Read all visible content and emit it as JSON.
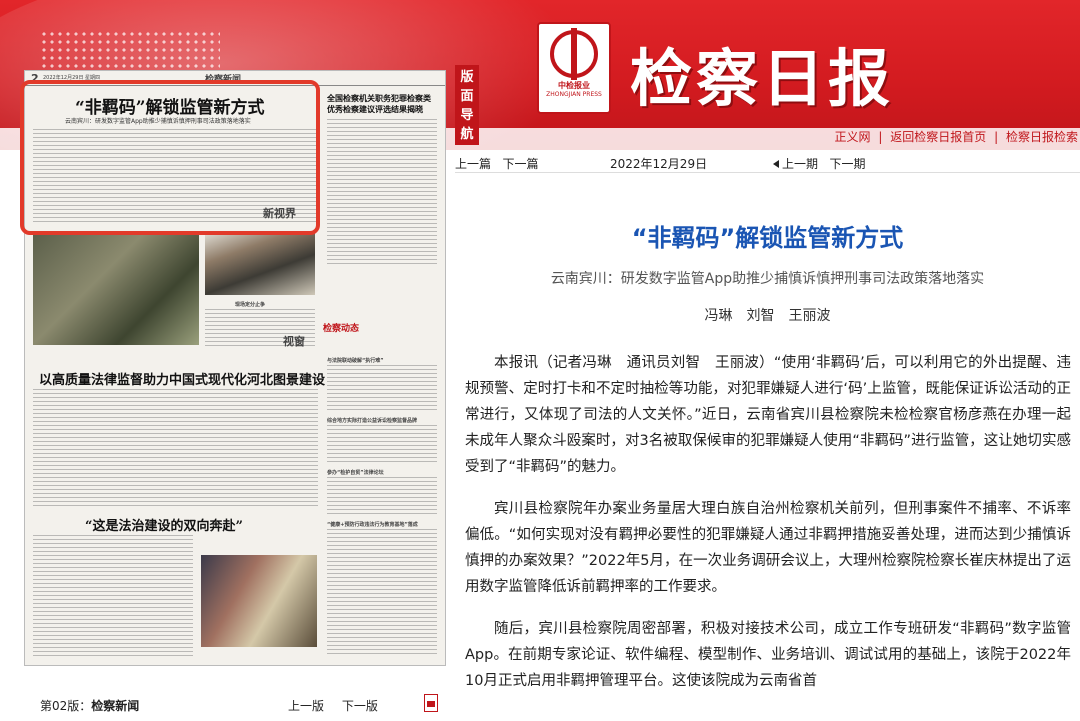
{
  "masthead": {
    "title": "检察日报",
    "logo_text": "中检报业",
    "logo_en": "ZHONGJIAN PRESS",
    "links": [
      "正义网",
      "返回检察日报首页",
      "检察日报检索"
    ],
    "link_separator": "|"
  },
  "edition_tab": "版面导航",
  "newspaper": {
    "page_no": "2",
    "header_text": "2022年12月29日  星期四",
    "section": "检察新闻",
    "headline_main": "“非羁码”解锁监管新方式",
    "headline_sub": "云南宾川：研发数字监管App助推少捕慎诉慎押刑事司法政策落地落实",
    "side_headline": "全国检察机关职务犯罪检察类优秀检察建议评选结果揭晓",
    "headline_2": "以高质量法律监督助力中国式现代化河北图景建设",
    "headline_3": "“这是法治建设的双向奔赴”",
    "xin_shijie": "新视界",
    "jiancha_dongtai": "检察动态",
    "shichuang": "视窗",
    "photo_caption": "现场定分止争",
    "small_items": [
      "与法院联动破解“执行难”",
      "综合地方实际打造公益诉讼检察监督品牌",
      "参办“检护自贸”法律论坛",
      "“健康+预防行政违法行为教育基地”落成"
    ]
  },
  "page_footer": {
    "page_label": "第02版：",
    "page_name": "检察新闻",
    "prev_page": "上一版",
    "next_page": "下一版"
  },
  "article_nav": {
    "prev_article": "上一篇",
    "next_article": "下一篇",
    "date": "2022年12月29日",
    "prev_issue": "上一期",
    "next_issue": "下一期"
  },
  "article": {
    "title": "“非羁码”解锁监管新方式",
    "subtitle": "云南宾川：研发数字监管App助推少捕慎诉慎押刑事司法政策落地落实",
    "authors": "冯琳　刘智　王丽波",
    "paragraphs": [
      "本报讯（记者冯琳　通讯员刘智　王丽波）“使用‘非羁码’后，可以利用它的外出提醒、违规预警、定时打卡和不定时抽检等功能，对犯罪嫌疑人进行‘码’上监管，既能保证诉讼活动的正常进行，又体现了司法的人文关怀。”近日，云南省宾川县检察院未检检察官杨彦燕在办理一起未成年人聚众斗殴案时，对3名被取保候审的犯罪嫌疑人使用“非羁码”进行监管，这让她切实感受到了“非羁码”的魅力。",
      "宾川县检察院年办案业务量居大理白族自治州检察机关前列，但刑事案件不捕率、不诉率偏低。“如何实现对没有羁押必要性的犯罪嫌疑人通过非羁押措施妥善处理，进而达到少捕慎诉慎押的办案效果？”2022年5月，在一次业务调研会议上，大理州检察院检察长崔庆林提出了运用数字监管降低诉前羁押率的工作要求。",
      "随后，宾川县检察院周密部署，积极对接技术公司，成立工作专班研发“非羁码”数字监管App。在前期专家论证、软件编程、模型制作、业务培训、调试试用的基础上，该院于2022年10月正式启用非羁押管理平台。这使该院成为云南省首"
    ]
  },
  "colors": {
    "brand_red": "#c0151a",
    "title_blue": "#1a55b3",
    "highlight_red": "#e23a2a"
  }
}
